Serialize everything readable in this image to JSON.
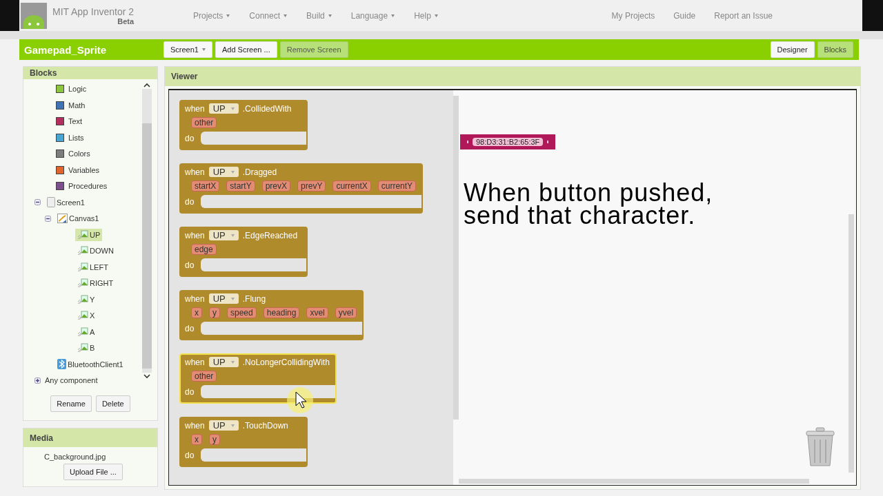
{
  "header": {
    "title": "MIT App Inventor 2",
    "subtitle": "Beta",
    "menus": [
      "Projects",
      "Connect",
      "Build",
      "Language",
      "Help"
    ],
    "links": [
      "My Projects",
      "Guide",
      "Report an Issue"
    ]
  },
  "project_bar": {
    "project": "Gamepad_Sprite",
    "screen_buttons": [
      {
        "label": "Screen1",
        "kind": "dropdown",
        "disabled": false
      },
      {
        "label": "Add Screen ...",
        "kind": "button",
        "disabled": false
      },
      {
        "label": "Remove Screen",
        "kind": "button",
        "disabled": true
      }
    ],
    "modes": [
      {
        "label": "Designer",
        "selected": false
      },
      {
        "label": "Blocks",
        "selected": true
      }
    ]
  },
  "blocks_panel": {
    "title": "Blocks",
    "builtin": [
      {
        "label": "Logic",
        "color": "#8cc63f"
      },
      {
        "label": "Math",
        "color": "#3f71b5"
      },
      {
        "label": "Text",
        "color": "#b32d5e"
      },
      {
        "label": "Lists",
        "color": "#49a6d4"
      },
      {
        "label": "Colors",
        "color": "#7d7d7d"
      },
      {
        "label": "Variables",
        "color": "#e0652d"
      },
      {
        "label": "Procedures",
        "color": "#7c4f8c"
      }
    ],
    "components": [
      {
        "label": "Screen1",
        "kind": "screen",
        "expanded": true,
        "selected": false,
        "children": [
          {
            "label": "Canvas1",
            "kind": "canvas",
            "expanded": true,
            "selected": false,
            "children": [
              {
                "label": "UP",
                "kind": "sprite",
                "selected": true
              },
              {
                "label": "DOWN",
                "kind": "sprite",
                "selected": false
              },
              {
                "label": "LEFT",
                "kind": "sprite",
                "selected": false
              },
              {
                "label": "RIGHT",
                "kind": "sprite",
                "selected": false
              },
              {
                "label": "Y",
                "kind": "sprite",
                "selected": false
              },
              {
                "label": "X",
                "kind": "sprite",
                "selected": false
              },
              {
                "label": "A",
                "kind": "sprite",
                "selected": false
              },
              {
                "label": "B",
                "kind": "sprite",
                "selected": false
              }
            ]
          },
          {
            "label": "BluetoothClient1",
            "kind": "bluetooth",
            "selected": false
          }
        ]
      }
    ],
    "any_component": {
      "label": "Any component",
      "expanded": false
    },
    "buttons": [
      "Rename",
      "Delete"
    ]
  },
  "media": {
    "title": "Media",
    "files": [
      "C_background.jpg"
    ],
    "button": "Upload File ..."
  },
  "viewer": {
    "title": "Viewer",
    "flyout_blocks": [
      {
        "keyword": "when",
        "component": "UP",
        "event": ".CollidedWith",
        "params": [
          "other"
        ],
        "do": "do",
        "highlighted": false
      },
      {
        "keyword": "when",
        "component": "UP",
        "event": ".Dragged",
        "params": [
          "startX",
          "startY",
          "prevX",
          "prevY",
          "currentX",
          "currentY"
        ],
        "do": "do",
        "highlighted": false
      },
      {
        "keyword": "when",
        "component": "UP",
        "event": ".EdgeReached",
        "params": [
          "edge"
        ],
        "do": "do",
        "highlighted": false
      },
      {
        "keyword": "when",
        "component": "UP",
        "event": ".Flung",
        "params": [
          "x",
          "y",
          "speed",
          "heading",
          "xvel",
          "yvel"
        ],
        "do": "do",
        "highlighted": false
      },
      {
        "keyword": "when",
        "component": "UP",
        "event": ".NoLongerCollidingWith",
        "params": [
          "other"
        ],
        "do": "do",
        "highlighted": true
      },
      {
        "keyword": "when",
        "component": "UP",
        "event": ".TouchDown",
        "params": [
          "x",
          "y"
        ],
        "do": "do",
        "highlighted": false
      }
    ],
    "text_block": "98:D3:31:B2:65:3F"
  },
  "caption": [
    "When button pushed,",
    "send that character."
  ]
}
